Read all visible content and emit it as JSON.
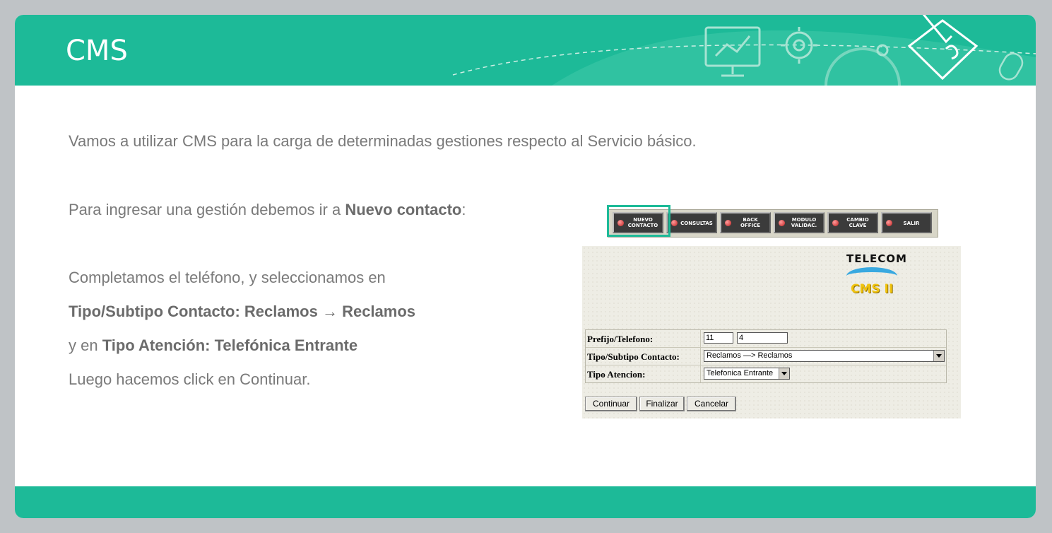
{
  "header": {
    "title": "CMS"
  },
  "body": {
    "intro": "Vamos a utilizar CMS para la carga de determinadas gestiones respecto al Servicio básico.",
    "line2_prefix": "Para ingresar una gestión debemos ir a ",
    "line2_bold": "Nuevo contacto",
    "line2_suffix": ":",
    "line3": "Completamos el teléfono, y seleccionamos en",
    "line4_bold1": "Tipo/Subtipo Contacto: Reclamos ",
    "line4_arrow": "→",
    "line4_bold2": " Reclamos",
    "line5_prefix": "y en ",
    "line5_bold": "Tipo Atención: Telefónica Entrante",
    "line6": "Luego hacemos click en Continuar."
  },
  "toolbar": {
    "buttons": [
      {
        "line1": "NUEVO",
        "line2": "CONTACTO"
      },
      {
        "line1": "CONSULTAS",
        "line2": ""
      },
      {
        "line1": "BACK",
        "line2": "OFFICE"
      },
      {
        "line1": "MODULO",
        "line2": "VALIDAC."
      },
      {
        "line1": "CAMBIO",
        "line2": "CLAVE"
      },
      {
        "line1": "SALIR",
        "line2": ""
      }
    ]
  },
  "cms_panel": {
    "brand": "TELECOM",
    "logo": "CMS II",
    "labels": {
      "phone": "Prefijo/Telefono:",
      "type": "Tipo/Subtipo Contacto:",
      "attention": "Tipo Atencion:"
    },
    "values": {
      "prefix": "11",
      "phone": "4",
      "type": "Reclamos —> Reclamos",
      "attention": "Telefonica Entrante"
    },
    "buttons": {
      "continue": "Continuar",
      "finish": "Finalizar",
      "cancel": "Cancelar"
    }
  },
  "colors": {
    "accent": "#1dba98",
    "background": "#bfc3c6"
  }
}
